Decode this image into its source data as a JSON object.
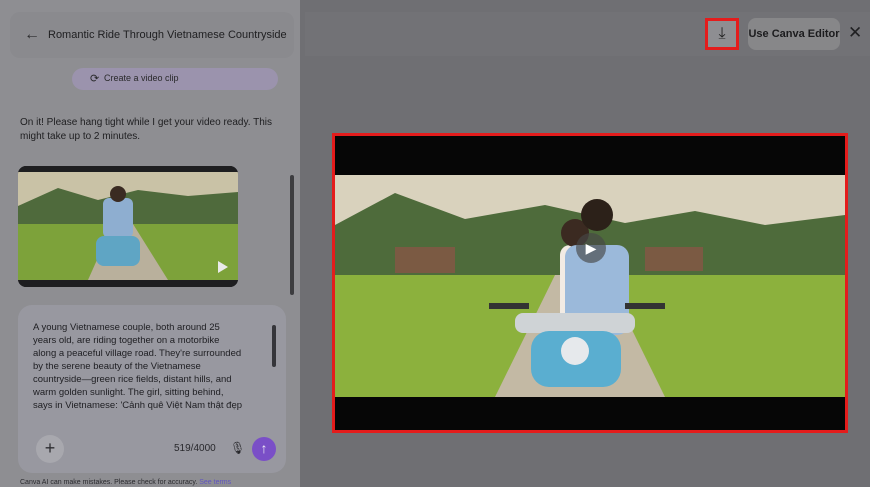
{
  "sidebar": {
    "back_icon": "back-arrow-icon",
    "title": "Romantic Ride Through Vietnamese Countryside",
    "create_clip_label": "Create a video clip",
    "message": "On it! Please hang tight while I get your video ready. This might take up to 2 minutes.",
    "prompt": {
      "text": "A young Vietnamese couple, both around 25\nyears old, are riding together on a motorbike\nalong a peaceful village road. They're surrounded\nby the serene beauty of the Vietnamese\ncountryside—green rice fields, distant hills, and\nwarm golden sunlight. The girl, sitting behind,\nsays in Vietnamese: 'Cảnh quê Việt Nam thật đẹp",
      "char_count": "519/4000",
      "add_icon": "plus-icon",
      "mic_icon": "microphone-icon",
      "send_icon": "arrow-up-icon"
    },
    "disclaimer": "Canva AI can make mistakes. Please check for accuracy.",
    "disclaimer_link": "See terms"
  },
  "toolbar": {
    "download_icon": "download-icon",
    "editor_label": "Use Canva Editor",
    "close_icon": "close-icon"
  },
  "video": {
    "play_icon": "play-icon"
  },
  "colors": {
    "highlight": "#e41c1c",
    "send_button": "#7a4fc7"
  }
}
